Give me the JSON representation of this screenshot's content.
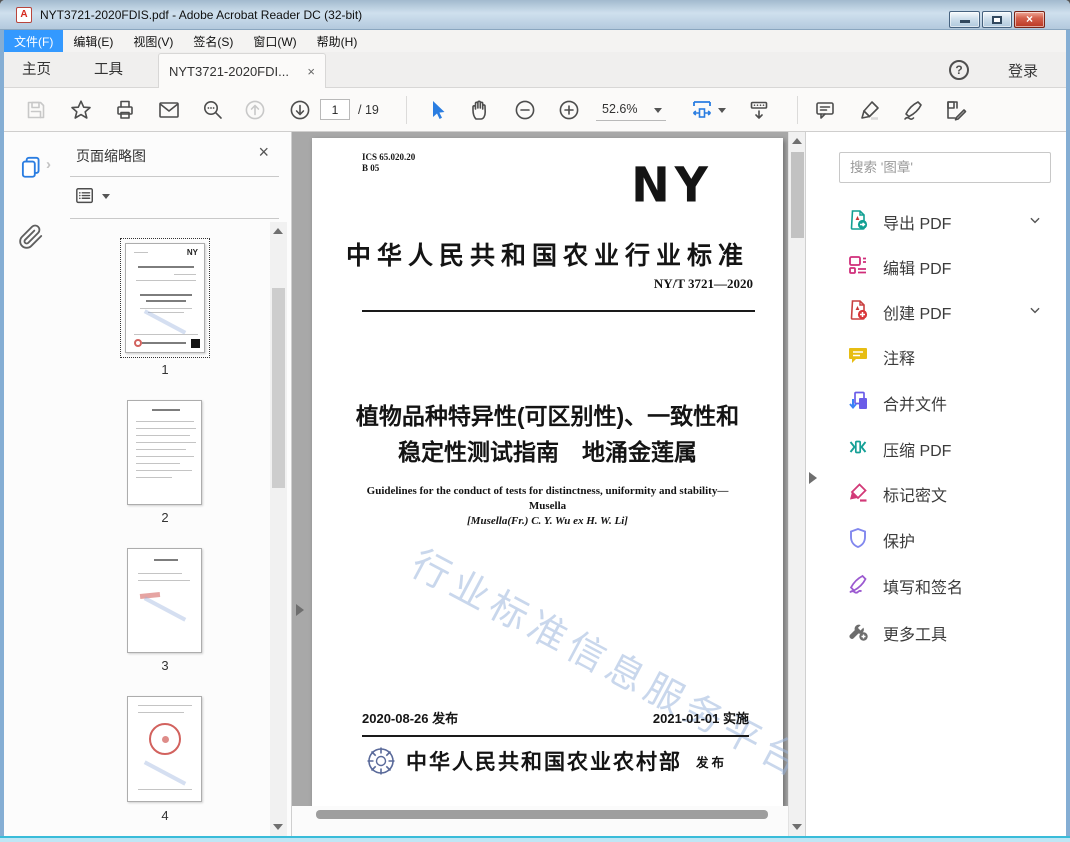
{
  "window": {
    "title": "NYT3721-2020FDIS.pdf - Adobe Acrobat Reader DC (32-bit)"
  },
  "icons": {
    "pdf_logo": "A",
    "help": "?",
    "tab_close": "×",
    "panel_close": "×",
    "rail_notch": "›"
  },
  "menu": {
    "items": [
      {
        "label": "文件(F)",
        "selected": true
      },
      {
        "label": "编辑(E)"
      },
      {
        "label": "视图(V)"
      },
      {
        "label": "签名(S)"
      },
      {
        "label": "窗口(W)"
      },
      {
        "label": "帮助(H)"
      }
    ]
  },
  "tabbar": {
    "home": "主页",
    "tools": "工具",
    "document_tab": "NYT3721-2020FDI...",
    "login": "登录"
  },
  "toolbar": {
    "page_current": "1",
    "page_total": "/ 19",
    "zoom_value": "52.6%"
  },
  "left_panel": {
    "title": "页面缩略图",
    "thumbnails": [
      {
        "label": "1"
      },
      {
        "label": "2"
      },
      {
        "label": "3"
      },
      {
        "label": "4"
      }
    ]
  },
  "document": {
    "ics_line1": "ICS 65.020.20",
    "ics_line2": "B 05",
    "logo": "NY",
    "standard_name": "中华人民共和国农业行业标准",
    "standard_number": "NY/T 3721—2020",
    "title_line1": "植物品种特异性(可区别性)、一致性和",
    "title_line2": "稳定性测试指南　地涌金莲属",
    "english_line1": "Guidelines for the conduct of tests for distinctness, uniformity and stability—",
    "english_line2": "Musella",
    "english_line3": "[Musella(Fr.) C. Y. Wu ex H. W. Li]",
    "watermark": "行业标准信息服务平台",
    "issue_date": "2020-08-26 发布",
    "implement_date": "2021-01-01 实施",
    "publisher": "中华人民共和国农业农村部",
    "publish_label": "发布"
  },
  "right_panel": {
    "search_placeholder": "搜索 '图章'",
    "tools": [
      {
        "label": "导出 PDF",
        "expandable": true
      },
      {
        "label": "编辑 PDF"
      },
      {
        "label": "创建 PDF",
        "expandable": true
      },
      {
        "label": "注释"
      },
      {
        "label": "合并文件"
      },
      {
        "label": "压缩 PDF"
      },
      {
        "label": "标记密文"
      },
      {
        "label": "保护"
      },
      {
        "label": "填写和签名"
      },
      {
        "label": "更多工具"
      }
    ]
  },
  "colors": {
    "selection_blue": "#3399ff",
    "accent_blue": "#2a7de1",
    "document_background": "#a8a8a8",
    "watermark_blue": "#9db7dd",
    "close_button_red": "#b93722",
    "export_teal": "#12a093",
    "edit_magenta": "#d02d7a",
    "create_red": "#d9363a",
    "comment_yellow": "#e7bd13",
    "combine_indigo": "#6a5ce8",
    "compress_teal": "#14a096",
    "redact_pink": "#d23a78",
    "protect_periwinkle": "#8187ee",
    "fillsign_purple": "#9b59d0",
    "more_tools_gray": "#6d6d6d"
  }
}
